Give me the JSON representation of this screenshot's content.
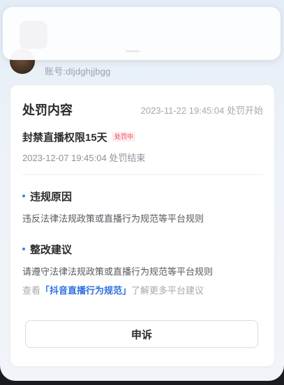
{
  "account": "账号:dljdghjjbgg",
  "penalty": {
    "section_title": "处罚内容",
    "start_time": "2023-11-22 19:45:04 处罚开始",
    "name": "封禁直播权限15天",
    "status_badge": "处罚中",
    "end_time": "2023-12-07 19:45:04 处罚结束"
  },
  "violation": {
    "title": "违规原因",
    "text": "违反法律法规政策或直播行为规范等平台规则"
  },
  "suggestion": {
    "title": "整改建议",
    "text": "请遵守法律法规政策或直播行为规范等平台规则",
    "guide_prefix": "查看",
    "guide_link": "「抖音直播行为规范」",
    "guide_suffix": "了解更多平台建议"
  },
  "appeal_button": "申诉",
  "colors": {
    "accent": "#3f7cf5",
    "link": "#2f6fe0",
    "status_red": "#f0455a"
  }
}
